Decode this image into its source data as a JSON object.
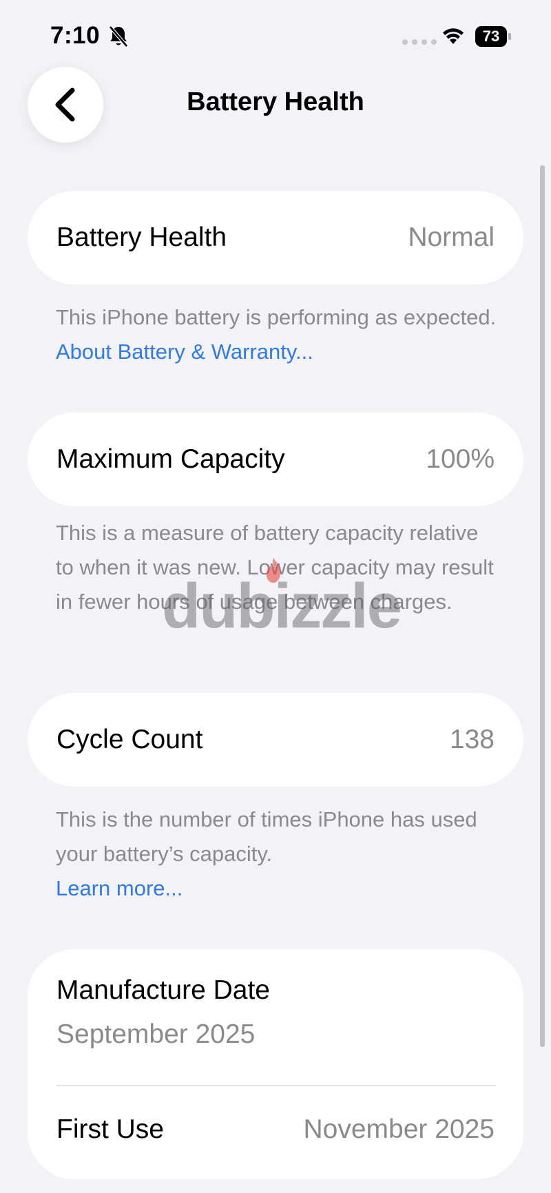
{
  "status_bar": {
    "time": "7:10",
    "battery_level": "73"
  },
  "nav": {
    "title": "Battery Health"
  },
  "battery_health": {
    "label": "Battery Health",
    "value": "Normal",
    "footnote": "This iPhone battery is performing as expected. ",
    "link": "About Battery & Warranty..."
  },
  "maximum_capacity": {
    "label": "Maximum Capacity",
    "value": "100%",
    "footnote": "This is a measure of battery capacity relative to when it was new. Lower capacity may result in fewer hours of usage between charges."
  },
  "cycle_count": {
    "label": "Cycle Count",
    "value": "138",
    "footnote": "This is the number of times iPhone has used your battery’s capacity.",
    "link": "Learn more..."
  },
  "dates": {
    "manufacture_label": "Manufacture Date",
    "manufacture_value": "September 2025",
    "first_use_label": "First Use",
    "first_use_value": "November 2025"
  },
  "watermark": {
    "text": "dubizzle"
  },
  "colors": {
    "background": "#f2f2f7",
    "card": "#ffffff",
    "secondary_text": "#8a8a8e",
    "link": "#2f7ae5",
    "watermark_accent": "#e8473e"
  },
  "icons": {
    "back": "chevron-left-icon",
    "silent": "bell-slash-icon",
    "wifi": "wifi-icon",
    "cellular": "cellular-dots-icon",
    "battery": "battery-icon"
  }
}
